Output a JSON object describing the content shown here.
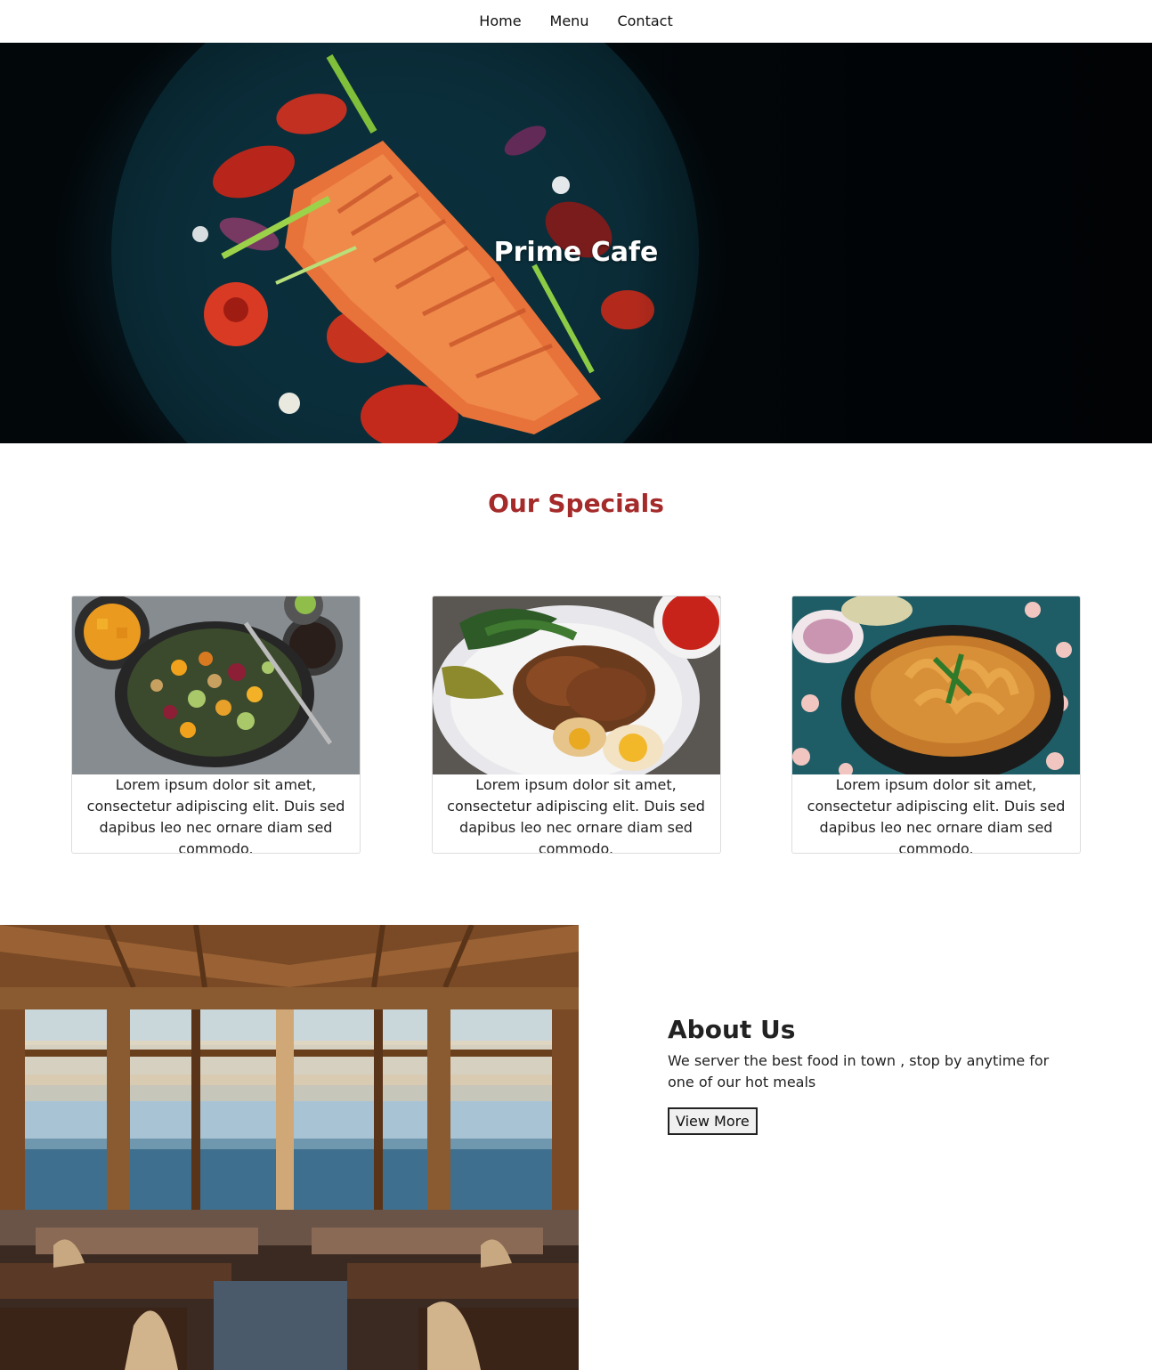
{
  "nav": {
    "items": [
      {
        "label": "Home"
      },
      {
        "label": "Menu"
      },
      {
        "label": "Contact"
      }
    ]
  },
  "hero": {
    "title": "Prime Cafe",
    "image": "salmon-dish-photo"
  },
  "specials": {
    "title": "Our Specials",
    "cards": [
      {
        "image": "salad-bowl-photo",
        "text": "Lorem ipsum dolor sit amet, consectetur adipiscing elit. Duis sed dapibus leo nec ornare diam sed commodo."
      },
      {
        "image": "braised-pork-rice-photo",
        "text": "Lorem ipsum dolor sit amet, consectetur adipiscing elit. Duis sed dapibus leo nec ornare diam sed commodo."
      },
      {
        "image": "curry-noodle-bowl-photo",
        "text": "Lorem ipsum dolor sit amet, consectetur adipiscing elit. Duis sed dapibus leo nec ornare diam sed commodo."
      }
    ]
  },
  "about": {
    "image": "seaside-restaurant-interior-photo",
    "title": "About Us",
    "text": "We server the best food in town , stop by anytime for one of our hot meals",
    "button_label": "View More"
  },
  "colors": {
    "accent": "#a52a2a",
    "text": "#222222"
  }
}
